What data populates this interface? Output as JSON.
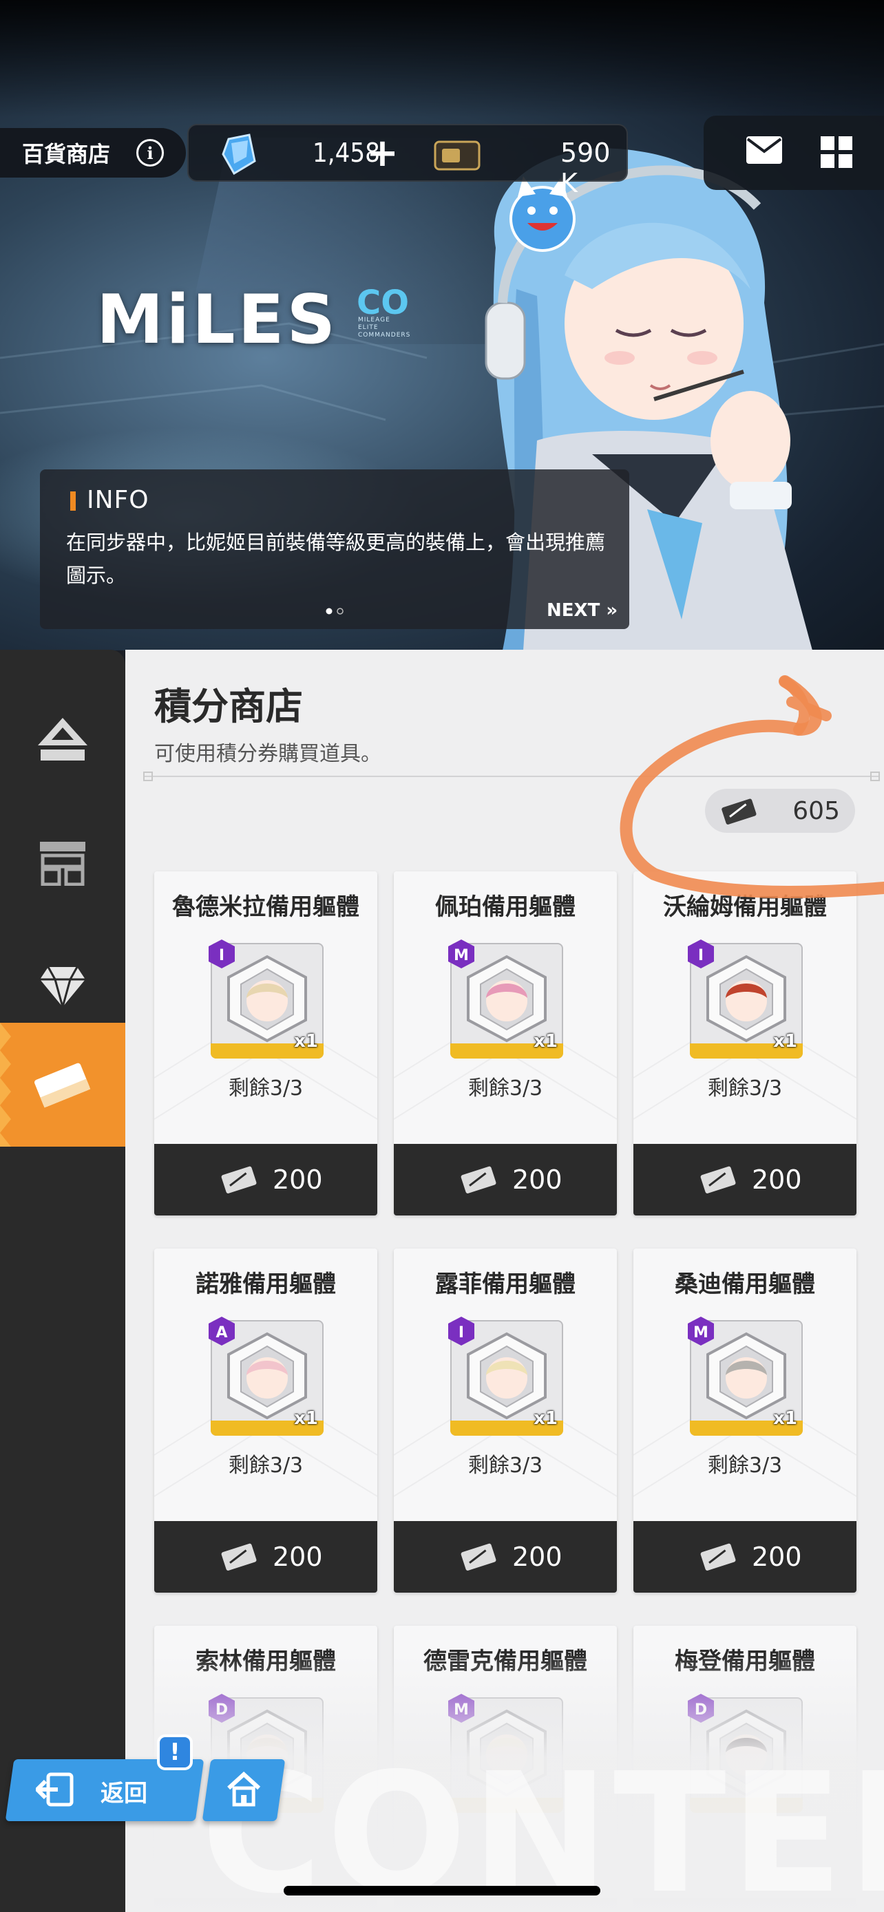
{
  "header": {
    "shop_name": "百貨商店",
    "info_icon": "info-icon",
    "gems": "1,458",
    "gems_plus": "+",
    "credits": "590 K",
    "icons": [
      "mail-icon",
      "grid-menu-icon"
    ]
  },
  "banner": {
    "logo": "MiLES",
    "logo_co": "CO",
    "logo_sub": "MILEAGE\nELITE\nCOMMANDERS",
    "info_title": "INFO",
    "info_text": "在同步器中，比妮姬目前裝備等級更高的裝備上，會出現推薦圖示。",
    "next_label": "NEXT »",
    "page_dots": 2,
    "active_dot": 0
  },
  "sidebar": {
    "items": [
      {
        "icon": "general-shop-icon",
        "active": false
      },
      {
        "icon": "arena-shop-icon",
        "active": false
      },
      {
        "icon": "gem-shop-icon",
        "active": false
      },
      {
        "icon": "ticket-shop-icon",
        "active": true
      }
    ]
  },
  "main": {
    "title": "積分商店",
    "subtitle": "可使用積分券購買道具。",
    "balance": "605",
    "balance_icon": "mileage-ticket-icon"
  },
  "items": [
    {
      "name": "魯德米拉備用軀體",
      "remain": "剩餘3/3",
      "price": "200",
      "qty": "x1",
      "class": "I",
      "badge_color": "#7a2fc0",
      "hair": "#e8d6b0"
    },
    {
      "name": "佩珀備用軀體",
      "remain": "剩餘3/3",
      "price": "200",
      "qty": "x1",
      "class": "M",
      "badge_color": "#7a2fc0",
      "hair": "#e79ab8"
    },
    {
      "name": "沃綸姆備用軀體",
      "remain": "剩餘3/3",
      "price": "200",
      "qty": "x1",
      "class": "I",
      "badge_color": "#7a2fc0",
      "hair": "#c0442e"
    },
    {
      "name": "諾雅備用軀體",
      "remain": "剩餘3/3",
      "price": "200",
      "qty": "x1",
      "class": "A",
      "badge_color": "#7a2fc0",
      "hair": "#f2c4cc"
    },
    {
      "name": "露菲備用軀體",
      "remain": "剩餘3/3",
      "price": "200",
      "qty": "x1",
      "class": "I",
      "badge_color": "#7a2fc0",
      "hair": "#efe2b6"
    },
    {
      "name": "桑迪備用軀體",
      "remain": "剩餘3/3",
      "price": "200",
      "qty": "x1",
      "class": "M",
      "badge_color": "#7a2fc0",
      "hair": "#b5b2ae"
    },
    {
      "name": "索林備用軀體",
      "remain": "",
      "price": "",
      "qty": "",
      "class": "D",
      "badge_color": "#7a2fc0",
      "hair": "#e6d8c8"
    },
    {
      "name": "德雷克備用軀體",
      "remain": "",
      "price": "",
      "qty": "",
      "class": "M",
      "badge_color": "#7a2fc0",
      "hair": "#f2ead2"
    },
    {
      "name": "梅登備用軀體",
      "remain": "",
      "price": "",
      "qty": "",
      "class": "D",
      "badge_color": "#7a2fc0",
      "hair": "#3a3036"
    }
  ],
  "footer": {
    "back_label": "返回",
    "notice": "!",
    "watermark": "CONTENT"
  },
  "colors": {
    "accent": "#f2922c",
    "sidebar": "#2a2a2a",
    "panel": "#efeff0",
    "button_blue": "#3a9be6",
    "annotation": "#f08a50"
  }
}
